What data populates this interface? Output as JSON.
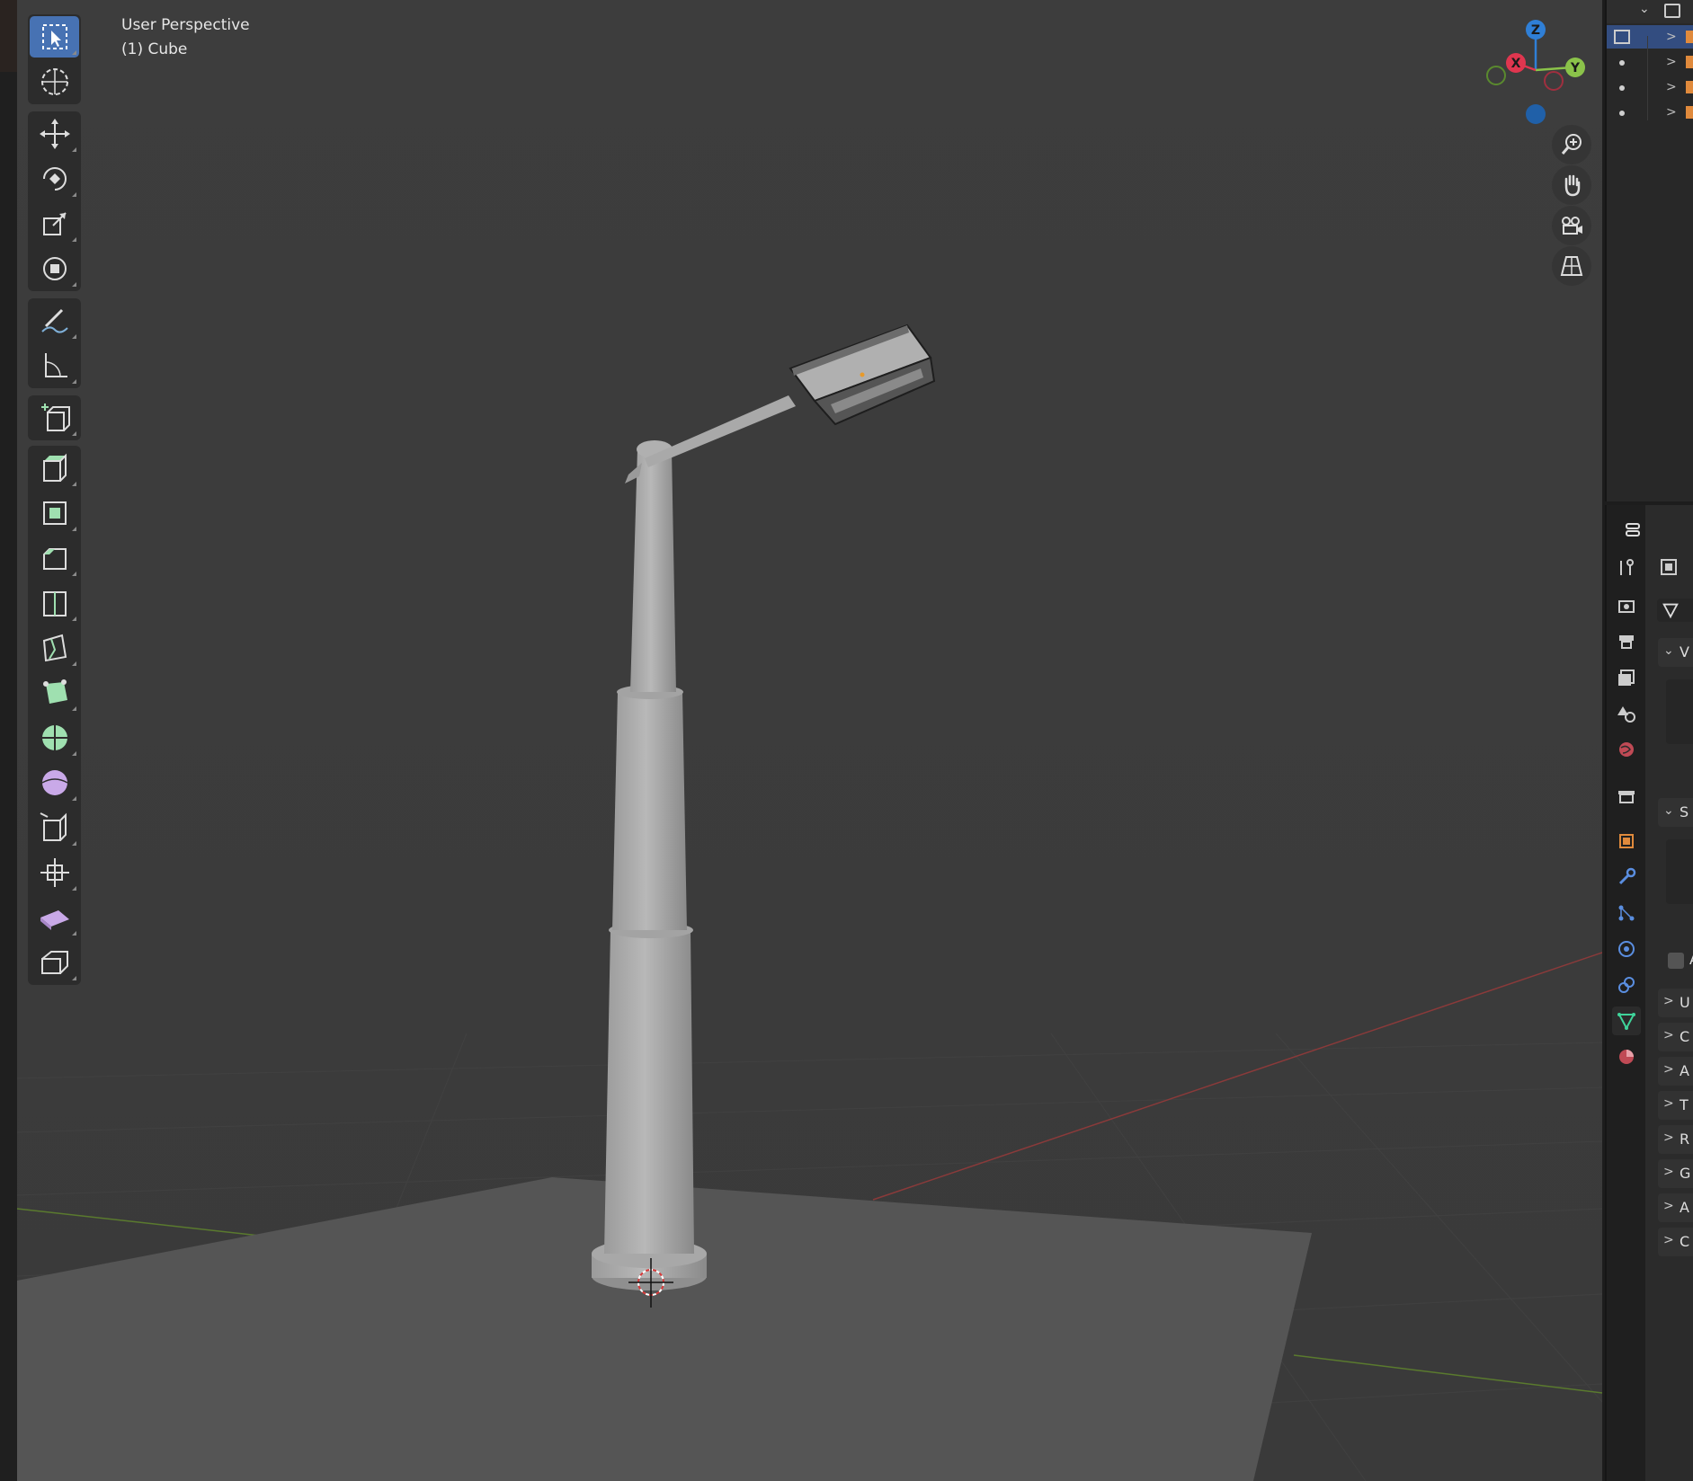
{
  "viewport": {
    "view_name": "User Perspective",
    "object_name": "(1) Cube"
  },
  "gizmo": {
    "axis_x": "X",
    "axis_y": "Y",
    "axis_z": "Z",
    "color_x": "#e0364f",
    "color_y": "#8bc34a",
    "color_z": "#2f7fd6"
  },
  "properties_panel": {
    "section_labels": [
      "V",
      "S",
      "A",
      "U",
      "C",
      "A",
      "T",
      "R",
      "G",
      "A",
      "C"
    ]
  },
  "outliner": {
    "rows": [
      "row-1",
      "row-2",
      "row-3",
      "row-4"
    ]
  },
  "colors": {
    "accent": "#4772b3",
    "background": "#3d3d3d",
    "panel": "#2b2b2b"
  }
}
